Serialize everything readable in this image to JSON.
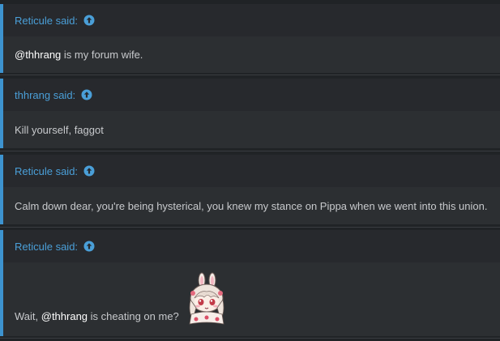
{
  "quotes": [
    {
      "author": "Reticule said:",
      "mention": "@thhrang",
      "text_before": "",
      "text_after": " is my forum wife."
    },
    {
      "author": "thhrang said:",
      "text": "Kill yourself, faggot"
    },
    {
      "author": "Reticule said:",
      "text": "Calm down dear, you're being hysterical, you knew my stance on Pippa when we went into this union."
    },
    {
      "author": "Reticule said:",
      "text_before": "Wait, ",
      "mention": "@thhrang",
      "text_after": " is cheating on me?"
    }
  ],
  "icons": {
    "jump": "arrow-up-circle-icon",
    "sticker": "anime-bunny-girl-sticker"
  },
  "colors": {
    "accent": "#3d93cf",
    "author_link": "#4a9fd8",
    "quote_bg": "#2c2f32",
    "quote_head_bg": "#27292d",
    "page_bg": "#202326",
    "text": "#c7c9cc",
    "mention": "#ffffff"
  }
}
